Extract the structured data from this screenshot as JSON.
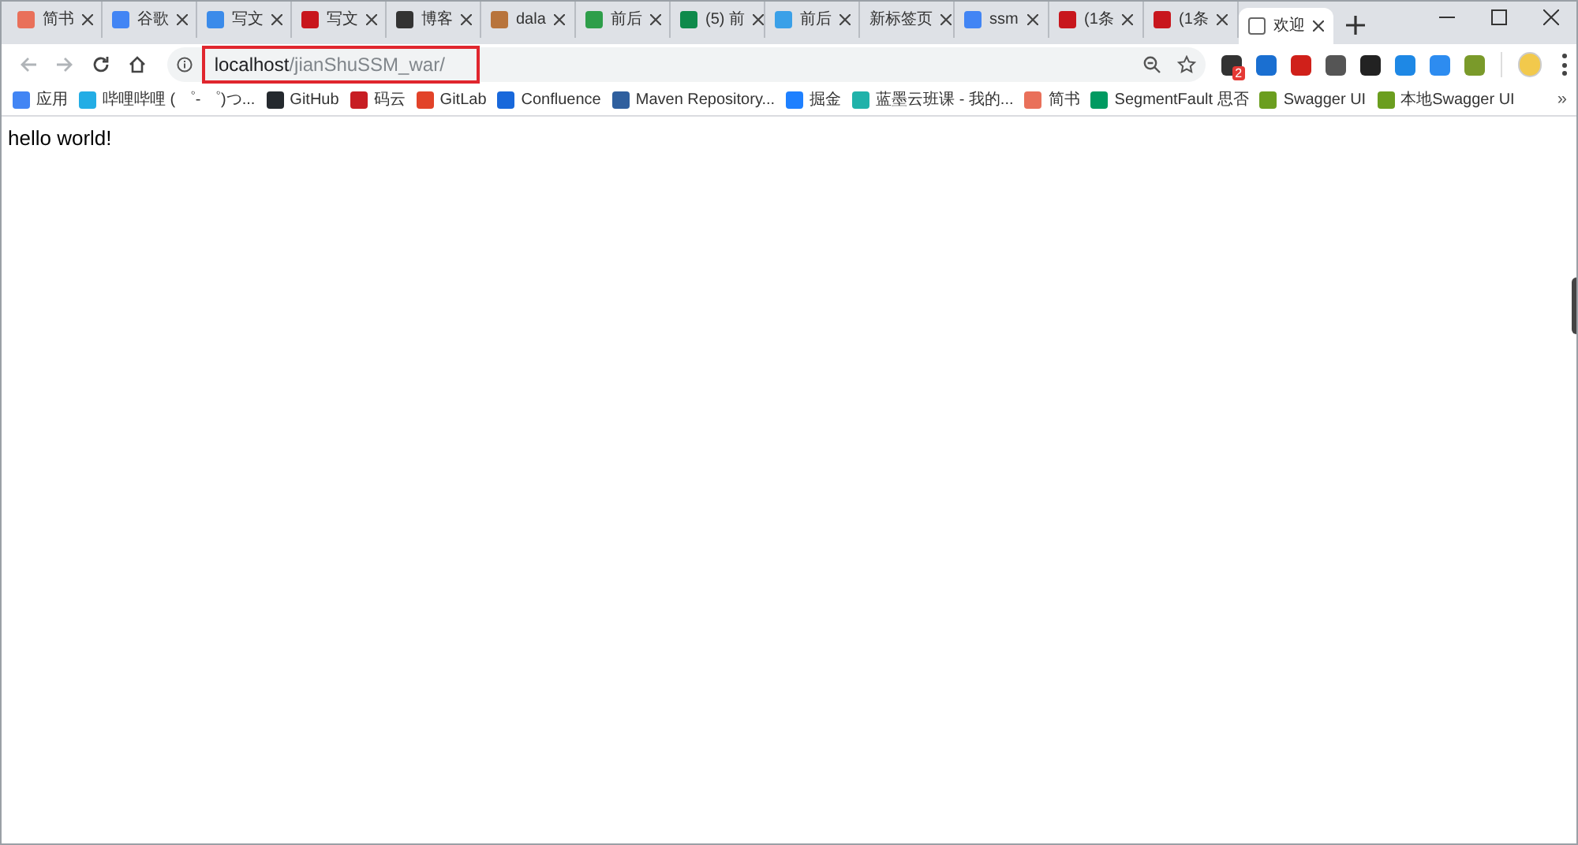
{
  "tabs": [
    {
      "title": "简书",
      "color": "#e9705a",
      "selected": false
    },
    {
      "title": "谷歌",
      "color": "#4285f4",
      "selected": false
    },
    {
      "title": "写文",
      "color": "#3b8bea",
      "selected": false
    },
    {
      "title": "写文",
      "color": "#c8161d",
      "selected": false
    },
    {
      "title": "博客",
      "color": "#333333",
      "selected": false
    },
    {
      "title": "dala",
      "color": "#b8743c",
      "selected": false
    },
    {
      "title": "前后",
      "color": "#2e9e4a",
      "selected": false
    },
    {
      "title": "(5) 前",
      "color": "#0e8a4b",
      "selected": false
    },
    {
      "title": "前后",
      "color": "#3aa0e8",
      "selected": false
    },
    {
      "title": "新标签页",
      "selected": false
    },
    {
      "title": "ssm",
      "color": "#4285f4",
      "selected": false
    },
    {
      "title": "(1条",
      "color": "#c8161d",
      "selected": false
    },
    {
      "title": "(1条",
      "color": "#c8161d",
      "selected": false
    },
    {
      "title": "欢迎",
      "color": "#ffffff",
      "selected": true
    }
  ],
  "address": {
    "host": "localhost",
    "path": "/jianShuSSM_war/"
  },
  "extensions": [
    {
      "color": "#333333",
      "badge": "2"
    },
    {
      "color": "#1a6fd1"
    },
    {
      "color": "#d0201a"
    },
    {
      "color": "#555555"
    },
    {
      "color": "#222222"
    },
    {
      "color": "#1e88e5"
    },
    {
      "color": "#2d8cf0"
    },
    {
      "color": "#7a9a2a"
    }
  ],
  "bookmarks": [
    {
      "label": "应用",
      "color": "#4285f4"
    },
    {
      "label": "哔哩哔哩 ( ゜- ゜)つ...",
      "color": "#23ade5"
    },
    {
      "label": "GitHub",
      "color": "#24292e"
    },
    {
      "label": "码云",
      "color": "#c71d23"
    },
    {
      "label": "GitLab",
      "color": "#e24329"
    },
    {
      "label": "Confluence",
      "color": "#1868db"
    },
    {
      "label": "Maven Repository...",
      "color": "#2f5f9e"
    },
    {
      "label": "掘金",
      "color": "#1e80ff"
    },
    {
      "label": "蓝墨云班课 - 我的...",
      "color": "#20b2aa"
    },
    {
      "label": "简书",
      "color": "#e9705a"
    },
    {
      "label": "SegmentFault 思否",
      "color": "#009a61"
    },
    {
      "label": "Swagger UI",
      "color": "#6b9e1f"
    },
    {
      "label": "本地Swagger UI",
      "color": "#6b9e1f"
    }
  ],
  "more_bookmarks": "»",
  "content": {
    "text": "hello world!"
  }
}
